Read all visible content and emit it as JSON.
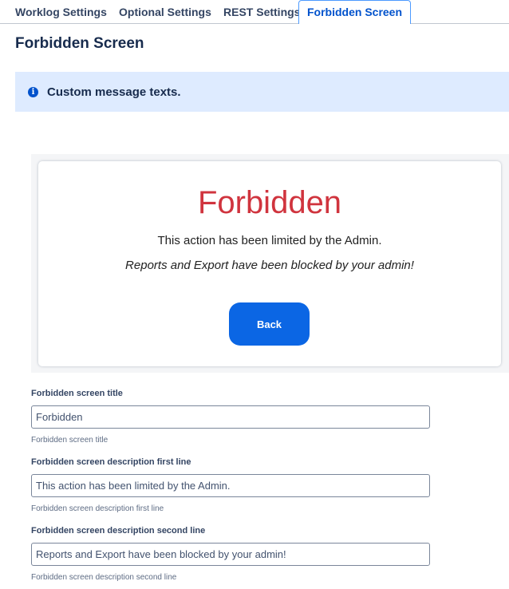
{
  "tabs": [
    {
      "label": "Worklog Settings"
    },
    {
      "label": "Optional Settings"
    },
    {
      "label": "REST Settings"
    },
    {
      "label": "Forbidden Screen",
      "active": true
    }
  ],
  "page_title": "Forbidden Screen",
  "info_banner": {
    "icon": "info-icon",
    "text": "Custom message texts."
  },
  "preview": {
    "title": "Forbidden",
    "line1": "This action has been limited by the Admin.",
    "line2": "Reports and Export have been blocked by your admin!",
    "back_label": "Back"
  },
  "fields": [
    {
      "label": "Forbidden screen title",
      "value": "Forbidden",
      "help": "Forbidden screen title"
    },
    {
      "label": "Forbidden screen description first line",
      "value": "This action has been limited by the Admin.",
      "help": "Forbidden screen description first line"
    },
    {
      "label": "Forbidden screen description second line",
      "value": "Reports and Export have been blocked by your admin!",
      "help": "Forbidden screen description second line"
    }
  ],
  "colors": {
    "accent": "#0052cc",
    "info_bg": "#deebff",
    "forbidden_title": "#d0343e",
    "back_button": "#0b66e4"
  }
}
